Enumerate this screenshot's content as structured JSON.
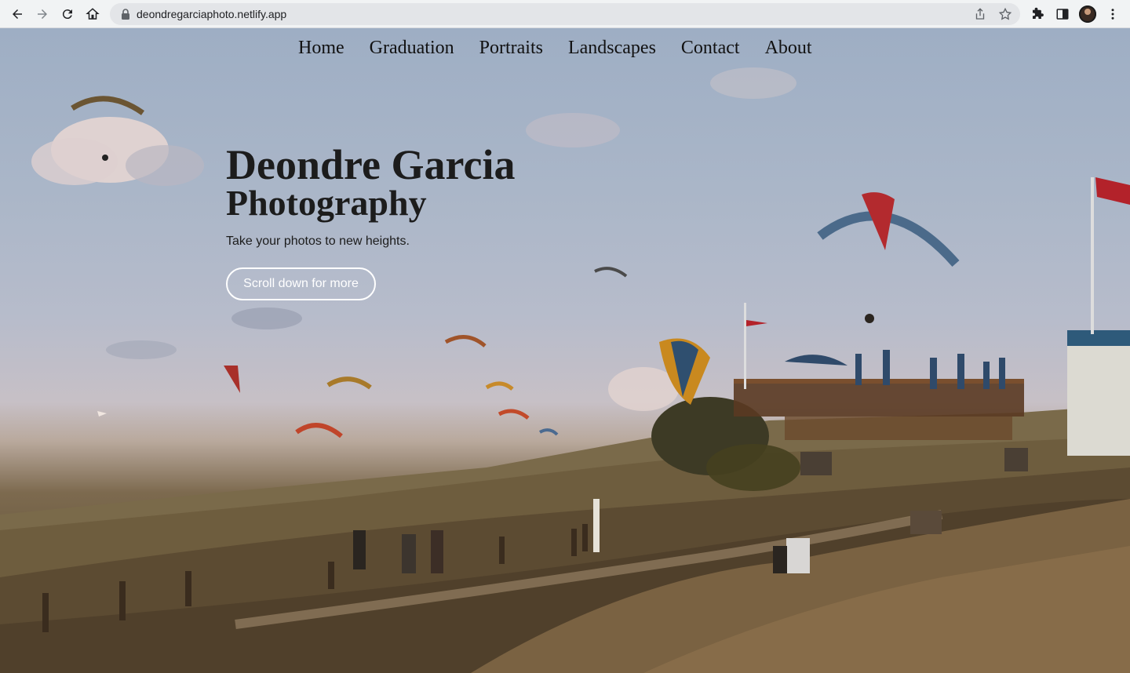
{
  "browser": {
    "url": "deondregarciaphoto.netlify.app",
    "icons": [
      "back-icon",
      "forward-icon",
      "reload-icon",
      "home-icon",
      "lock-icon",
      "share-icon",
      "star-icon",
      "extensions-icon",
      "sidebar-icon",
      "profile-avatar",
      "kebab-menu-icon"
    ]
  },
  "site": {
    "nav": [
      "Home",
      "Graduation",
      "Portraits",
      "Landscapes",
      "Contact",
      "About"
    ],
    "title_line1": "Deondre Garcia",
    "title_line2": "Photography",
    "tagline": "Take your photos to new heights.",
    "cta_label": "Scroll down for more"
  }
}
